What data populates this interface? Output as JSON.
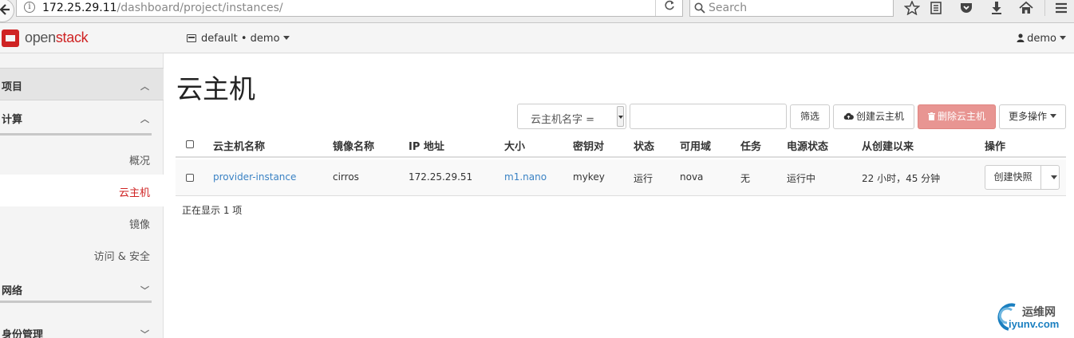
{
  "browser": {
    "url_host": "172.25.29.11",
    "url_path": "/dashboard/project/instances/",
    "search_placeholder": "Search"
  },
  "header": {
    "brand_prefix": "open",
    "brand_suffix": "stack",
    "project_selector": "default • demo",
    "user": "demo",
    "accent_color": "#cf2323"
  },
  "sidebar": {
    "project": "项目",
    "compute": "计算",
    "items": [
      {
        "label": "概况",
        "active": false
      },
      {
        "label": "云主机",
        "active": true
      },
      {
        "label": "镜像",
        "active": false
      },
      {
        "label": "访问 & 安全",
        "active": false
      }
    ],
    "network": "网络",
    "identity": "身份管理"
  },
  "main": {
    "title": "云主机",
    "filter_field": "云主机名字 =",
    "filter_value": "",
    "filter_button": "筛选",
    "launch_button": "创建云主机",
    "delete_button": "删除云主机",
    "more_button": "更多操作",
    "columns": [
      "云主机名称",
      "镜像名称",
      "IP 地址",
      "大小",
      "密钥对",
      "状态",
      "可用域",
      "任务",
      "电源状态",
      "从创建以来",
      "操作"
    ],
    "rows": [
      {
        "name": "provider-instance",
        "image": "cirros",
        "ip": "172.25.29.51",
        "size": "m1.nano",
        "keypair": "mykey",
        "status": "运行",
        "zone": "nova",
        "task": "无",
        "power": "运行中",
        "age": "22 小时，45 分钟",
        "action": "创建快照"
      }
    ],
    "footer": "正在显示 1 项"
  },
  "watermark": {
    "zh": "运维网",
    "en": "iyunv.com"
  }
}
